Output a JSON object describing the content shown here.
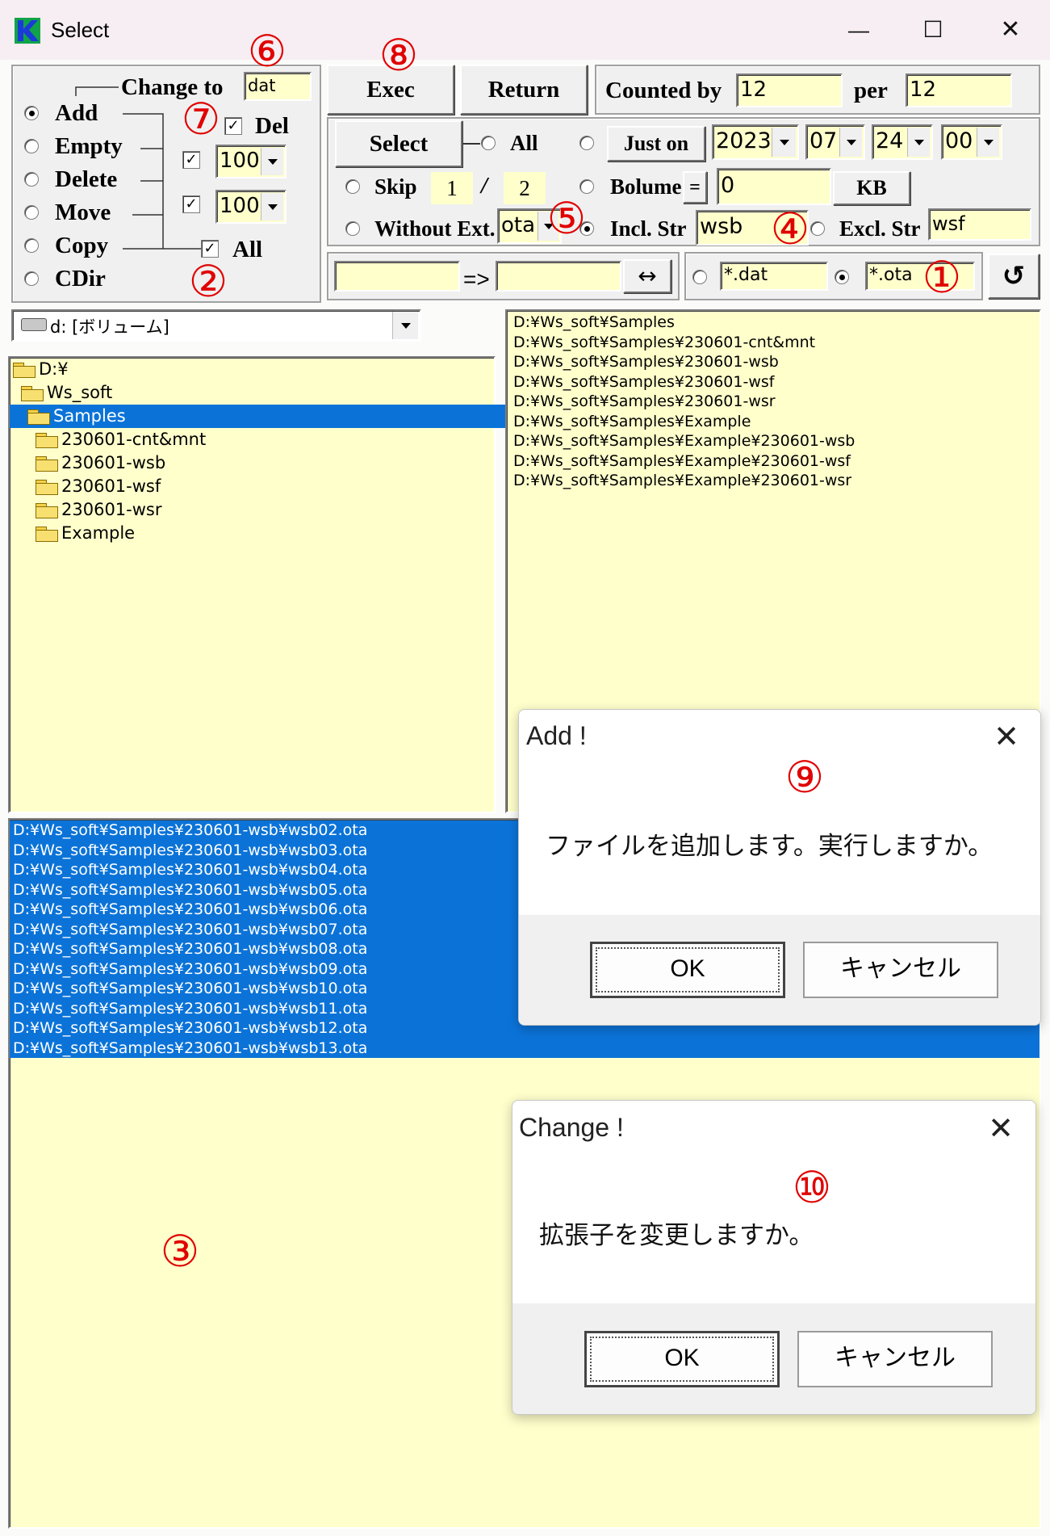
{
  "window": {
    "title": "Select",
    "minimize_glyph": "—",
    "maximize_glyph": "☐",
    "close_glyph": "✕"
  },
  "mode_group": {
    "change_to_label": "Change to",
    "change_to_value": "dat",
    "modes": [
      "Add",
      "Empty",
      "Delete",
      "Move",
      "Copy",
      "CDir"
    ],
    "selected_mode": "Add",
    "del_label": "Del",
    "del_checked": true,
    "size1_value": "100",
    "size2_value": "100",
    "size1_checked": true,
    "size2_checked": true,
    "all_label": "All",
    "all_checked": true
  },
  "toolbar": {
    "exec_label": "Exec",
    "return_label": "Return",
    "counted_by_label": "Counted by",
    "counted_by_value": "12",
    "per_label": "per",
    "per_value": "12"
  },
  "select_group": {
    "select_label": "Select",
    "all_label": "All",
    "just_on_label": "Just on",
    "year": "2023",
    "month": "07",
    "day": "24",
    "hour": "00",
    "skip_label": "Skip",
    "skip_a": "1",
    "skip_sep": "/",
    "skip_b": "2",
    "bolume_label": "Bolume",
    "bolume_op": "=",
    "bolume_value": "0",
    "kb_label": "KB",
    "without_ext_label": "Without Ext.",
    "without_ext_value": "ota",
    "incl_label": "Incl. Str",
    "incl_value": "wsb",
    "excl_label": "Excl. Str",
    "excl_value": "wsf"
  },
  "rename": {
    "from_value": "",
    "arrow": "=>",
    "to_value": "",
    "swap_glyph": "↔"
  },
  "filters": {
    "filter1": "*.dat",
    "filter2": "*.ota",
    "selected": "*.ota",
    "refresh_glyph": "↺"
  },
  "drive": {
    "label": "d: [ボリューム]"
  },
  "tree": [
    {
      "label": "D:¥",
      "level": 0,
      "open": true,
      "selected": false
    },
    {
      "label": "Ws_soft",
      "level": 1,
      "open": true,
      "selected": false
    },
    {
      "label": "Samples",
      "level": 2,
      "open": true,
      "selected": true
    },
    {
      "label": "230601-cnt&mnt",
      "level": 3,
      "open": false,
      "selected": false
    },
    {
      "label": "230601-wsb",
      "level": 3,
      "open": false,
      "selected": false
    },
    {
      "label": "230601-wsf",
      "level": 3,
      "open": false,
      "selected": false
    },
    {
      "label": "230601-wsr",
      "level": 3,
      "open": false,
      "selected": false
    },
    {
      "label": "Example",
      "level": 3,
      "open": false,
      "selected": false
    }
  ],
  "dir_list": [
    "D:¥Ws_soft¥Samples",
    "D:¥Ws_soft¥Samples¥230601-cnt&mnt",
    "D:¥Ws_soft¥Samples¥230601-wsb",
    "D:¥Ws_soft¥Samples¥230601-wsf",
    "D:¥Ws_soft¥Samples¥230601-wsr",
    "D:¥Ws_soft¥Samples¥Example",
    "D:¥Ws_soft¥Samples¥Example¥230601-wsb",
    "D:¥Ws_soft¥Samples¥Example¥230601-wsf",
    "D:¥Ws_soft¥Samples¥Example¥230601-wsr"
  ],
  "file_list": [
    "D:¥Ws_soft¥Samples¥230601-wsb¥wsb02.ota",
    "D:¥Ws_soft¥Samples¥230601-wsb¥wsb03.ota",
    "D:¥Ws_soft¥Samples¥230601-wsb¥wsb04.ota",
    "D:¥Ws_soft¥Samples¥230601-wsb¥wsb05.ota",
    "D:¥Ws_soft¥Samples¥230601-wsb¥wsb06.ota",
    "D:¥Ws_soft¥Samples¥230601-wsb¥wsb07.ota",
    "D:¥Ws_soft¥Samples¥230601-wsb¥wsb08.ota",
    "D:¥Ws_soft¥Samples¥230601-wsb¥wsb09.ota",
    "D:¥Ws_soft¥Samples¥230601-wsb¥wsb10.ota",
    "D:¥Ws_soft¥Samples¥230601-wsb¥wsb11.ota",
    "D:¥Ws_soft¥Samples¥230601-wsb¥wsb12.ota",
    "D:¥Ws_soft¥Samples¥230601-wsb¥wsb13.ota"
  ],
  "dialog_add": {
    "title": "Add !",
    "message": "ファイルを追加します。実行しますか。",
    "ok": "OK",
    "cancel": "キャンセル",
    "close_glyph": "✕"
  },
  "dialog_change": {
    "title": "Change !",
    "message": "拡張子を変更しますか。",
    "ok": "OK",
    "cancel": "キャンセル",
    "close_glyph": "✕"
  },
  "annotations": [
    "①",
    "②",
    "③",
    "④",
    "⑤",
    "⑥",
    "⑦",
    "⑧",
    "⑨",
    "⑩"
  ],
  "colors": {
    "pane_bg": "#ffffcc",
    "selection": "#0b73d8",
    "annotation": "#e00000"
  }
}
